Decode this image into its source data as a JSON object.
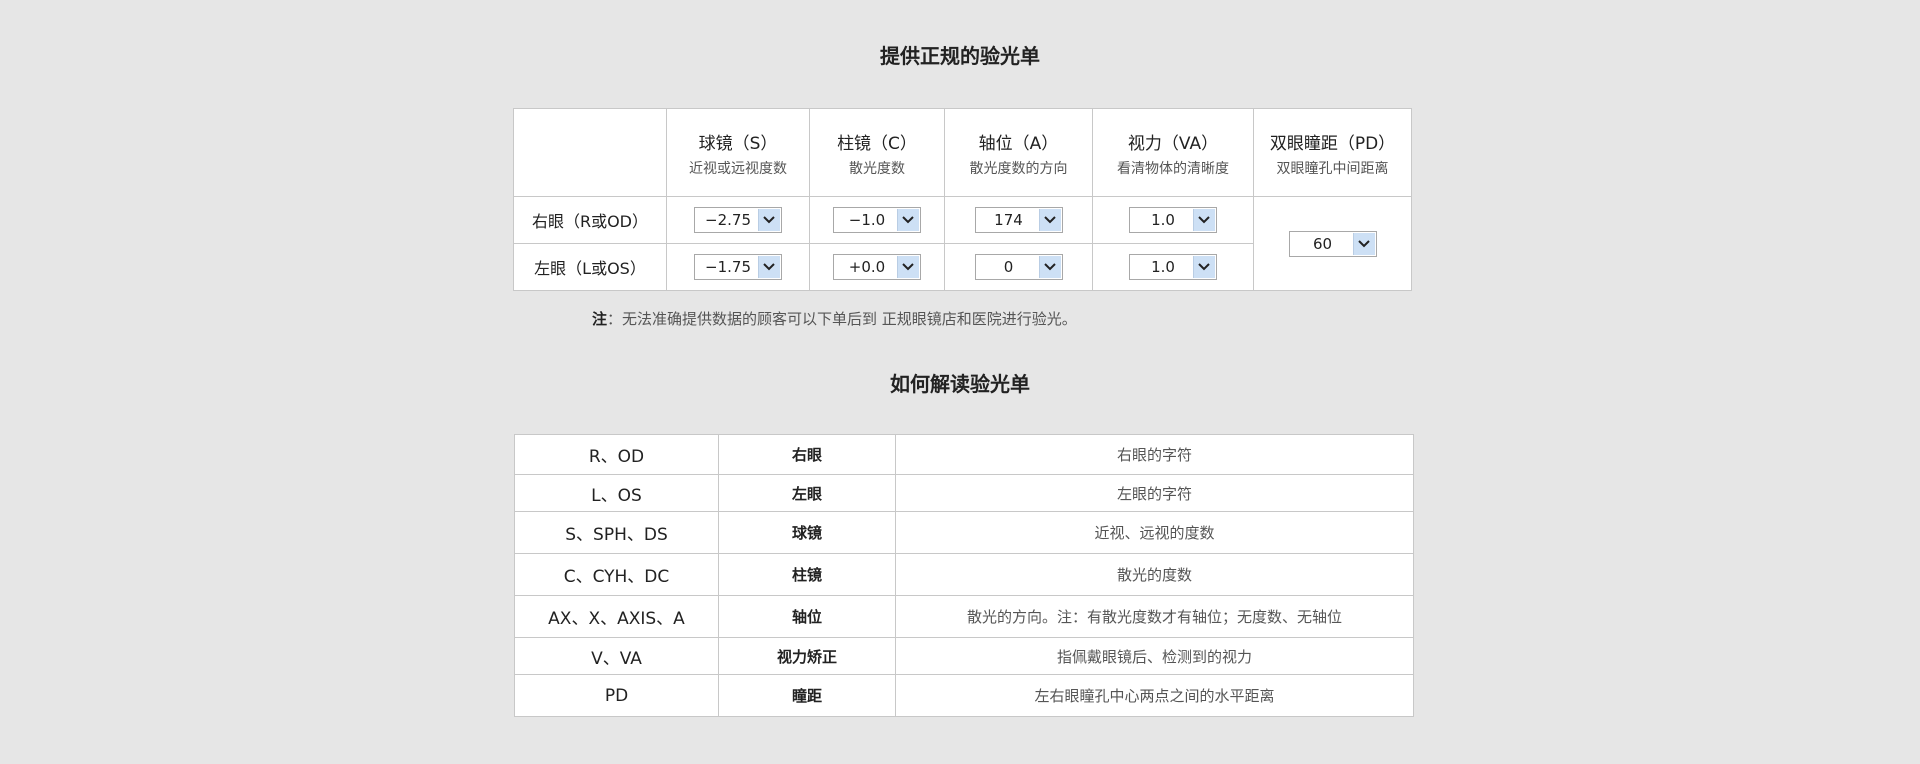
{
  "title_prescription": "提供正规的验光单",
  "title_guide": "如何解读验光单",
  "columns": [
    {
      "main": "球镜（S）",
      "sub": "近视或远视度数"
    },
    {
      "main": "柱镜（C）",
      "sub": "散光度数"
    },
    {
      "main": "轴位（A）",
      "sub": "散光度数的方向"
    },
    {
      "main": "视力（VA）",
      "sub": "看清物体的清晰度"
    },
    {
      "main": "双眼瞳距（PD）",
      "sub": "双眼瞳孔中间距离"
    }
  ],
  "rows": [
    {
      "label": "右眼（R或OD）",
      "sphere": "−2.75",
      "cylinder": "−1.0",
      "axis": "174",
      "va": "1.0"
    },
    {
      "label": "左眼（L或OS）",
      "sphere": "−1.75",
      "cylinder": "+0.0",
      "axis": "0",
      "va": "1.0"
    }
  ],
  "pd_value": "60",
  "note": {
    "prefix": "注",
    "text": "：无法准确提供数据的顾客可以下单后到 正规眼镜店和医院进行验光。"
  },
  "guide": [
    {
      "code": "R、OD",
      "name": "右眼",
      "desc": "右眼的字符"
    },
    {
      "code": "L、OS",
      "name": "左眼",
      "desc": "左眼的字符"
    },
    {
      "code": "S、SPH、DS",
      "name": "球镜",
      "desc": "近视、远视的度数"
    },
    {
      "code": "C、CYH、DC",
      "name": "柱镜",
      "desc": "散光的度数"
    },
    {
      "code": "AX、X、AXIS、A",
      "name": "轴位",
      "desc": "散光的方向。注：有散光度数才有轴位；无度数、无轴位"
    },
    {
      "code": "V、VA",
      "name": "视力矫正",
      "desc": "指佩戴眼镜后、检测到的视力"
    },
    {
      "code": "PD",
      "name": "瞳距",
      "desc": "左右眼瞳孔中心两点之间的水平距离"
    }
  ]
}
